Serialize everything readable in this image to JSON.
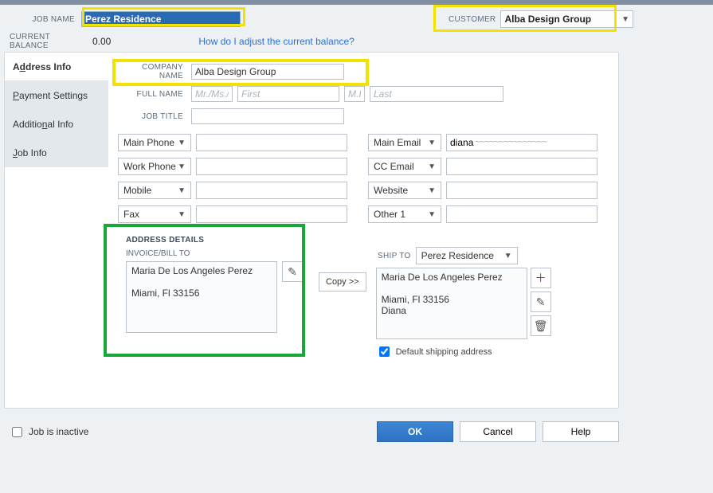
{
  "header": {
    "job_name_label": "JOB NAME",
    "job_name_value": "Perez Residence",
    "customer_label": "CUSTOMER",
    "customer_value": "Alba Design Group"
  },
  "balance": {
    "label": "CURRENT BALANCE",
    "value": "0.00",
    "adjust_link": "How do I adjust the current balance?"
  },
  "tabs": [
    {
      "label_pre": "A",
      "u": "d",
      "label_post": "dress Info"
    },
    {
      "label_pre": "",
      "u": "P",
      "label_post": "ayment Settings"
    },
    {
      "label_pre": "Additio",
      "u": "n",
      "label_post": "al Info"
    },
    {
      "label_pre": "",
      "u": "J",
      "label_post": "ob Info"
    }
  ],
  "company": {
    "label": "COMPANY NAME",
    "value": "Alba Design Group"
  },
  "fullname": {
    "label": "FULL NAME",
    "ph_prefix": "Mr./Ms./...",
    "ph_first": "First",
    "ph_mi": "M.I.",
    "ph_last": "Last"
  },
  "jobtitle": {
    "label": "JOB TITLE"
  },
  "phones": {
    "left": [
      "Main Phone",
      "Work Phone",
      "Mobile",
      "Fax"
    ],
    "right": [
      "Main Email",
      "CC Email",
      "Website",
      "Other 1"
    ],
    "main_email_value": "diana"
  },
  "address": {
    "title": "ADDRESS DETAILS",
    "bill_label": "INVOICE/BILL TO",
    "bill_text": "Maria De Los Angeles Perez\n\nMiami, Fl 33156",
    "copy_label": "Copy >>",
    "ship_label": "SHIP TO",
    "ship_select": "Perez Residence",
    "ship_text": "Maria De Los Angeles Perez\n\nMiami, Fl 33156\nDiana",
    "default_ship": "Default shipping address"
  },
  "footer": {
    "inactive": "Job is inactive",
    "ok": "OK",
    "cancel": "Cancel",
    "help": "Help"
  }
}
